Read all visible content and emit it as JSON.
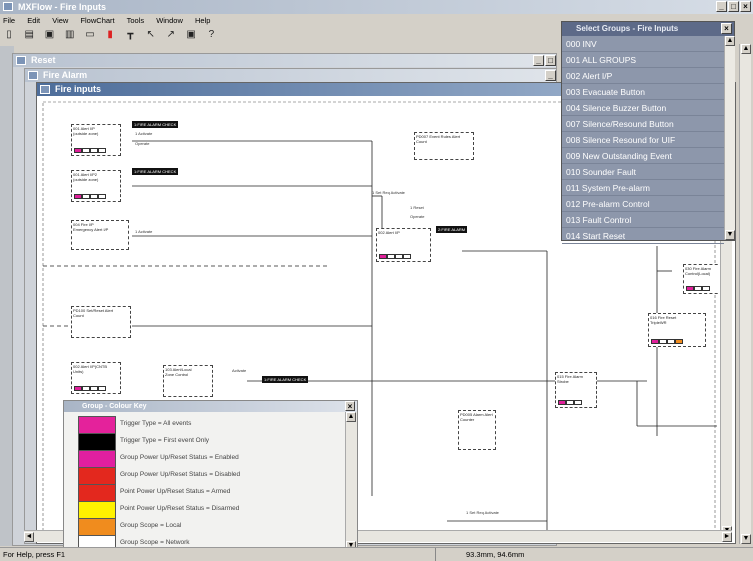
{
  "app": {
    "title": "MXFlow - Fire Inputs",
    "menu": [
      "File",
      "Edit",
      "View",
      "FlowChart",
      "Tools",
      "Window",
      "Help"
    ]
  },
  "toolbar": [
    "new",
    "open",
    "save",
    "print",
    "preview",
    "fire",
    "tree",
    "cursor",
    "chart",
    "save2",
    "help"
  ],
  "windows": {
    "reset": "Reset",
    "fire_alarm": "Fire Alarm",
    "fire_inputs": "Fire inputs"
  },
  "select_groups": {
    "title": "Select Groups - Fire Inputs",
    "items": [
      "000 INV",
      "001 ALL GROUPS",
      "002 Alert I/P",
      "003 Evacuate Button",
      "004 Silence Buzzer Button",
      "007 Silence/Resound Button",
      "008 Silence Resound for UIF",
      "009 New Outstanding Event",
      "010 Sounder Fault",
      "011 System Pre-alarm",
      "012 Pre-alarm Control",
      "013 Fault Control",
      "014 Start Reset"
    ]
  },
  "colour_key": {
    "title": "Group - Colour Key",
    "rows": [
      {
        "color": "#e4229b",
        "label": "Trigger Type = All events"
      },
      {
        "color": "#000000",
        "label": "Trigger Type = First event Only"
      },
      {
        "color": "#e01fa0",
        "label": "Group Power Up/Reset Status = Enabled"
      },
      {
        "color": "#e3281e",
        "label": "Group Power Up/Reset Status = Disabled"
      },
      {
        "color": "#e3281e",
        "label": "Point Power Up/Reset Status = Armed"
      },
      {
        "color": "#fff200",
        "label": "Point Power Up/Reset Status = Disarmed"
      },
      {
        "color": "#f08c1e",
        "label": "Group Scope = Local"
      },
      {
        "color": "#ffffff",
        "label": "Group Scope = Network"
      }
    ]
  },
  "status": {
    "help": "For Help, press F1",
    "coords": "93.3mm, 94.6mm"
  },
  "flow": {
    "nodes": [
      {
        "title": "001 Alert I/P",
        "sub": "(outside zone)"
      },
      {
        "title": "001 Alert I/P2",
        "sub": "(outside zone)"
      },
      {
        "title": "004 Fire I/P",
        "sub": "Emergency Alert I/P"
      },
      {
        "title": "PD100 Set/Reset Alert",
        "sub": "Count"
      },
      {
        "title": "002 Alert I/P(CNTB",
        "sub": "Units)"
      },
      {
        "title": "002 Alert I/P",
        "sub": ""
      },
      {
        "title": "PD007 Event Rules Alert",
        "sub": "Count"
      },
      {
        "title": "015 Fire Alarm",
        "sub": "Strobe"
      },
      {
        "title": "PD005 Alarm Alert",
        "sub": "Counter"
      },
      {
        "title": "016 Fire Reset",
        "sub": "TripleWR"
      },
      {
        "title": "103 Alert/Local",
        "sub": "Zone Control"
      },
      {
        "title": "030 Fire Alarm",
        "sub": "Control(Local)"
      }
    ],
    "tags": [
      "1:FIRE ALARM CHECK",
      "1:FIRE ALARM CHECK",
      "2:FIRE ALARM",
      "1:FIRE ALARM CHECK"
    ],
    "labels": [
      "1 Activate",
      "Operate",
      "1 Set Req Activate",
      "1 Reset",
      "1 Activate",
      "Operate",
      "Activate",
      "1 Set Req Activate"
    ]
  }
}
